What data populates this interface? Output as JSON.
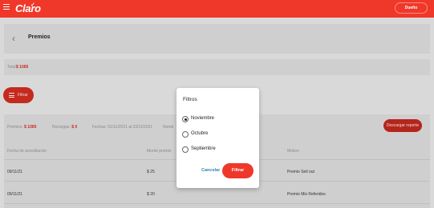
{
  "header": {
    "brand": "Claro",
    "user_button": "Dueño"
  },
  "page": {
    "title": "Premios"
  },
  "total": {
    "label": "Total",
    "value": "$ 1065"
  },
  "filter_button": {
    "label": "Filtrar"
  },
  "summary": {
    "premios_label": "Premios:",
    "premios_value": "$ 1065",
    "recargas_label": "Recargas:",
    "recargas_value": "$ 0",
    "fechas_label": "Fechas:",
    "fechas_value": "01/11/2021 al 23/11/2021",
    "extra_label": "Nomb"
  },
  "download_button": {
    "label": "Descargar reporte"
  },
  "table": {
    "headers": [
      "Fecha de acreditación",
      "Monto premio",
      "Motivo"
    ],
    "rows": [
      [
        "09/11/21",
        "$ 25",
        "Premio Sell out"
      ],
      [
        "09/11/21",
        "$ 20",
        "Premio Mis Referidos"
      ]
    ]
  },
  "modal": {
    "title": "Filtros",
    "options": [
      {
        "label": "Noviembre",
        "checked": true
      },
      {
        "label": "Octubre",
        "checked": false
      },
      {
        "label": "Septiembre",
        "checked": false
      }
    ],
    "cancel_label": "Cancelar",
    "apply_label": "Filtrar"
  },
  "colors": {
    "brand_red": "#ef3829",
    "link_blue": "#2a86a8"
  }
}
